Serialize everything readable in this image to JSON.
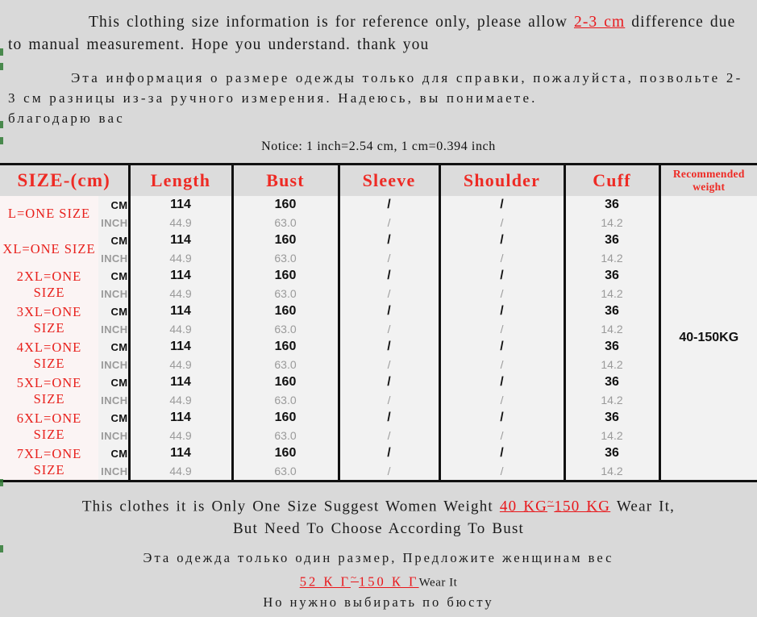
{
  "top_notice": {
    "english_part1": "This clothing size information is for reference only, please allow ",
    "english_highlight": "2-3 cm",
    "english_part2": " difference due to manual measurement. Hope you understand. thank you",
    "russian": "Эта информация о размере одежды только для справки, пожалуйста, позвольте 2-3 см разницы из-за ручного измерения. Надеюсь, вы понимаете.",
    "russian_line2": "благодарю вас"
  },
  "conversion_notice": "Notice: 1 inch=2.54 cm, 1 cm=0.394 inch",
  "table": {
    "headers": [
      "SIZE-(cm)",
      "Length",
      "Bust",
      "Sleeve",
      "Shoulder",
      "Cuff",
      "Recommended weight"
    ],
    "unit_labels": {
      "cm": "CM",
      "inch": "INCH"
    },
    "recommended_weight": "40-150KG",
    "rows": [
      {
        "size": "L=ONE SIZE",
        "cm": {
          "length": "114",
          "bust": "160",
          "sleeve": "/",
          "shoulder": "/",
          "cuff": "36"
        },
        "inch": {
          "length": "44.9",
          "bust": "63.0",
          "sleeve": "/",
          "shoulder": "/",
          "cuff": "14.2"
        }
      },
      {
        "size": "XL=ONE SIZE",
        "cm": {
          "length": "114",
          "bust": "160",
          "sleeve": "/",
          "shoulder": "/",
          "cuff": "36"
        },
        "inch": {
          "length": "44.9",
          "bust": "63.0",
          "sleeve": "/",
          "shoulder": "/",
          "cuff": "14.2"
        }
      },
      {
        "size": "2XL=ONE SIZE",
        "cm": {
          "length": "114",
          "bust": "160",
          "sleeve": "/",
          "shoulder": "/",
          "cuff": "36"
        },
        "inch": {
          "length": "44.9",
          "bust": "63.0",
          "sleeve": "/",
          "shoulder": "/",
          "cuff": "14.2"
        }
      },
      {
        "size": "3XL=ONE SIZE",
        "cm": {
          "length": "114",
          "bust": "160",
          "sleeve": "/",
          "shoulder": "/",
          "cuff": "36"
        },
        "inch": {
          "length": "44.9",
          "bust": "63.0",
          "sleeve": "/",
          "shoulder": "/",
          "cuff": "14.2"
        }
      },
      {
        "size": "4XL=ONE SIZE",
        "cm": {
          "length": "114",
          "bust": "160",
          "sleeve": "/",
          "shoulder": "/",
          "cuff": "36"
        },
        "inch": {
          "length": "44.9",
          "bust": "63.0",
          "sleeve": "/",
          "shoulder": "/",
          "cuff": "14.2"
        }
      },
      {
        "size": "5XL=ONE SIZE",
        "cm": {
          "length": "114",
          "bust": "160",
          "sleeve": "/",
          "shoulder": "/",
          "cuff": "36"
        },
        "inch": {
          "length": "44.9",
          "bust": "63.0",
          "sleeve": "/",
          "shoulder": "/",
          "cuff": "14.2"
        }
      },
      {
        "size": "6XL=ONE SIZE",
        "cm": {
          "length": "114",
          "bust": "160",
          "sleeve": "/",
          "shoulder": "/",
          "cuff": "36"
        },
        "inch": {
          "length": "44.9",
          "bust": "63.0",
          "sleeve": "/",
          "shoulder": "/",
          "cuff": "14.2"
        }
      },
      {
        "size": "7XL=ONE SIZE",
        "cm": {
          "length": "114",
          "bust": "160",
          "sleeve": "/",
          "shoulder": "/",
          "cuff": "36"
        },
        "inch": {
          "length": "44.9",
          "bust": "63.0",
          "sleeve": "/",
          "shoulder": "/",
          "cuff": "14.2"
        }
      }
    ]
  },
  "bottom_notice": {
    "english_part1": "This clothes it is Only One Size Suggest Women Weight ",
    "english_highlight_low": "40 KG",
    "english_tilde": "~",
    "english_highlight_high": "150 KG",
    "english_part2": " Wear It,",
    "english_line2": "But Need To Choose According To Bust",
    "russian_line1": "Эта одежда только один размер, Предложите женщинам вес",
    "russian_highlight_low": "52 К Г",
    "russian_tilde": "~",
    "russian_highlight_high": "150 К Г",
    "russian_wear": "Wear It",
    "russian_line3": "Но нужно выбирать по бюсту"
  },
  "colors": {
    "page_background": "#d9d9d9",
    "table_background": "#f2f2f2",
    "header_background": "#dcdcdc",
    "accent_red": "#ee2a24",
    "inch_gray": "#9a9a9a",
    "border_black": "#111111"
  }
}
